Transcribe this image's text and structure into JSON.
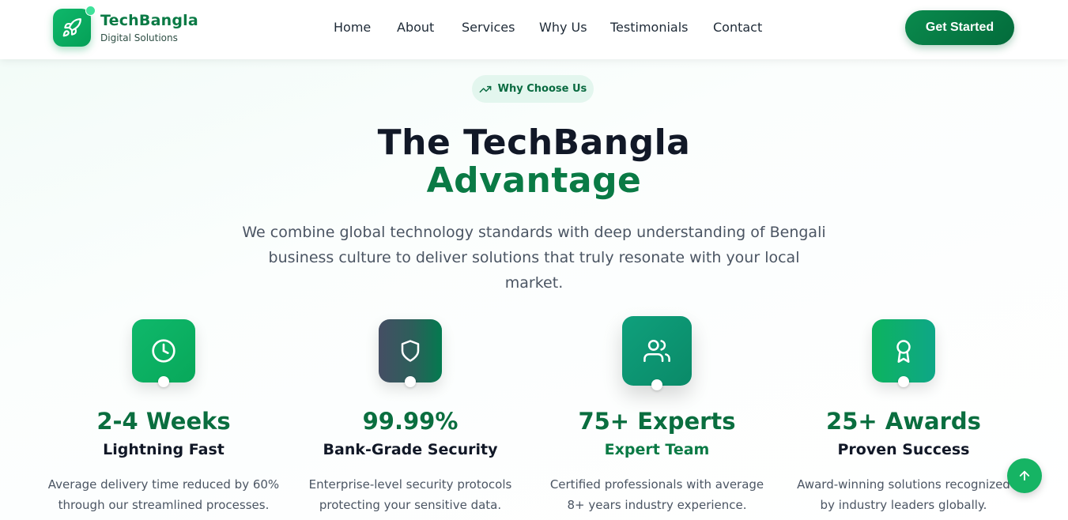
{
  "brand": {
    "name": "TechBangla",
    "subtitle": "Digital Solutions"
  },
  "nav": {
    "items": [
      "Home",
      "About",
      "Services",
      "Why Us",
      "Testimonials",
      "Contact"
    ],
    "cta_label": "Get Started"
  },
  "hero": {
    "badge": "Why Choose Us",
    "title_line1": "The TechBangla",
    "title_line2": "Advantage",
    "lead_line1": "We combine global technology standards with deep understanding of Bengali",
    "lead_line2": "business culture to deliver solutions that truly resonate with your local market."
  },
  "features": [
    {
      "value": "2-4 Weeks",
      "label": "Lightning Fast",
      "desc1": "Average delivery time reduced by 60%",
      "desc2": "through our streamlined processes.",
      "icon": "clock-icon"
    },
    {
      "value": "99.99%",
      "label": "Bank-Grade Security",
      "desc1": "Enterprise-level security protocols",
      "desc2": "protecting your sensitive data.",
      "icon": "shield-icon"
    },
    {
      "value": "75+ Experts",
      "label": "Expert Team",
      "desc1": "Certified professionals with average",
      "desc2": "8+ years industry experience.",
      "icon": "users-icon"
    },
    {
      "value": "25+ Awards",
      "label": "Proven Success",
      "desc1": "Award-winning solutions recognized",
      "desc2": "by industry leaders globally.",
      "icon": "award-icon"
    }
  ],
  "colors": {
    "brand_green": "#0a7a45",
    "accent": "#16b464",
    "text_dark": "#111827"
  }
}
